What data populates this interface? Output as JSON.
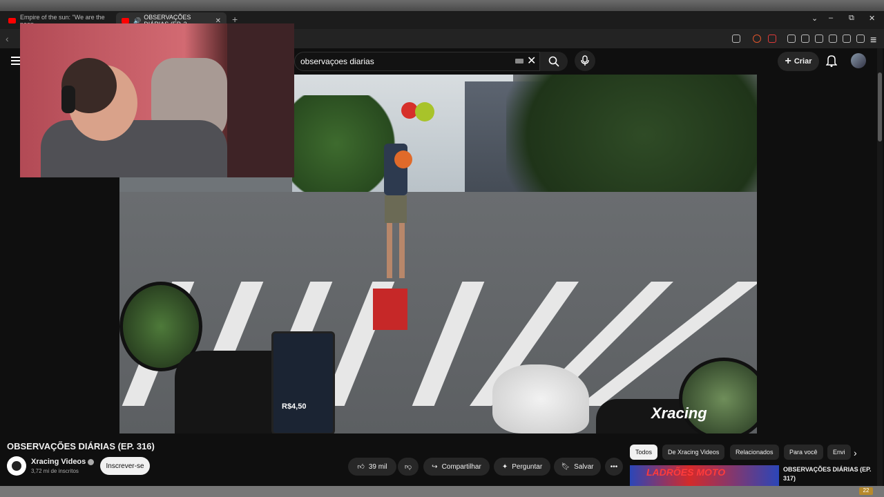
{
  "browser": {
    "tabs": [
      {
        "label": "Empire of the sun: \"We are the peop"
      },
      {
        "label": "OBSERVAÇÕES DIÁRIAS (EP. 3"
      }
    ],
    "newtab": "+"
  },
  "youtube": {
    "search": {
      "value": "observaçoes diarias"
    },
    "create_label": "Criar"
  },
  "video": {
    "phone_price": "R$4,50",
    "watermark": "Xracing"
  },
  "info": {
    "title": "OBSERVAÇÕES DIÁRIAS (EP. 316)",
    "channel": "Xracing Videos",
    "subscribers": "3,72 mi de inscritos",
    "subscribe_label": "Inscrever-se",
    "likes": "39 mil",
    "share_label": "Compartilhar",
    "ask_label": "Perguntar",
    "save_label": "Salvar"
  },
  "sidebar": {
    "chips": [
      {
        "label": "Todos"
      },
      {
        "label": "De Xracing Videos"
      },
      {
        "label": "Relacionados"
      },
      {
        "label": "Para você"
      },
      {
        "label": "Envi"
      }
    ],
    "recommended": {
      "thumb_text": "LADRÕES MOTO",
      "title": "OBSERVAÇÕES DIÁRIAS (EP. 317)"
    }
  },
  "taskbar": {
    "badge": "22"
  }
}
